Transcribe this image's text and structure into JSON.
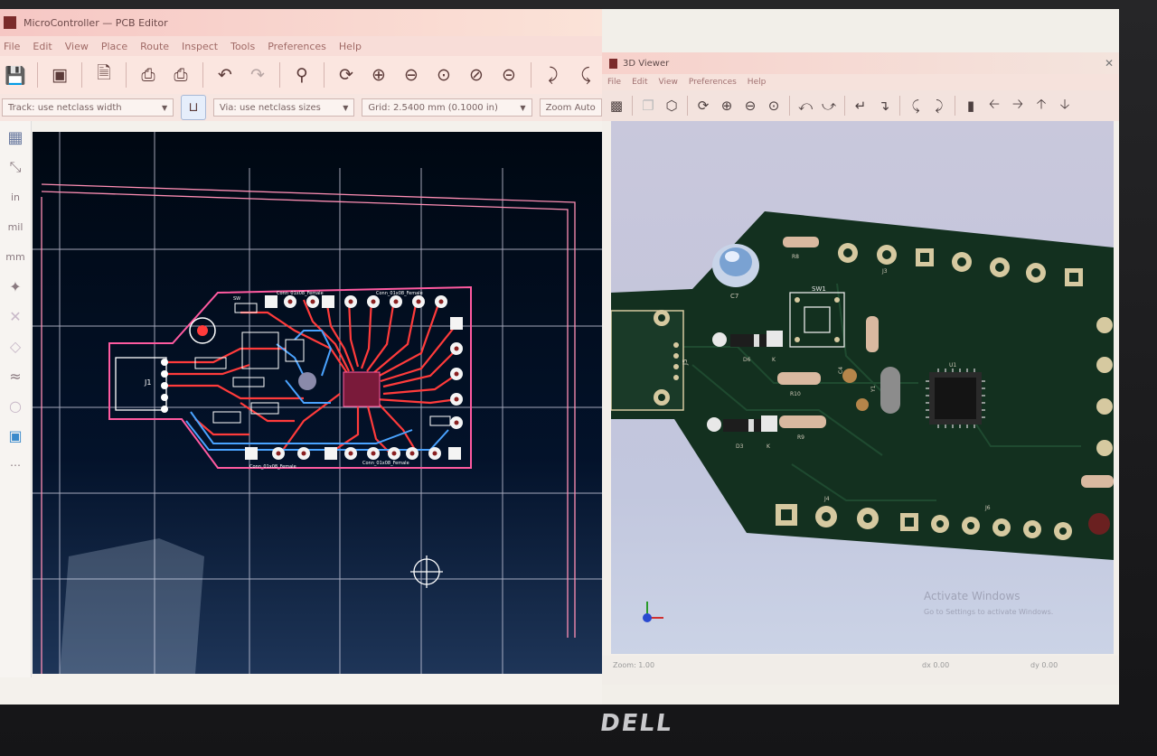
{
  "pcb_editor": {
    "window_title": "MicroController — PCB Editor",
    "menu": [
      "File",
      "Edit",
      "View",
      "Place",
      "Route",
      "Inspect",
      "Tools",
      "Preferences",
      "Help"
    ],
    "toolbar_icons": [
      "save-icon",
      "board-setup-icon",
      "new-page-icon",
      "print-icon",
      "plot-icon",
      "undo-icon",
      "redo-icon",
      "find-icon",
      "refresh-icon",
      "zoom-in-icon",
      "zoom-out-icon",
      "zoom-fit-icon",
      "zoom-objects-icon",
      "zoom-selection-icon",
      "flip-icon",
      "rotate-icon"
    ],
    "track_width": "Track: use netclass width",
    "via_size": "Via: use netclass sizes",
    "grid": "Grid: 2.5400 mm (0.1000 in)",
    "zoom": "Zoom Auto",
    "left_tool_labels": [
      "in",
      "mil",
      "mm"
    ],
    "board_labels": {
      "j1": "J1",
      "top_left": "SW",
      "top_mid": "Conn_01x08_Female",
      "top_right": "Conn_01x08_Female",
      "bottom_left": "Conn_01x08_Female",
      "bottom_right": "Conn_01x08_Female"
    },
    "colors": {
      "board_outline": "#ff5aa0",
      "copper": "#ff3b3b",
      "back_copper": "#4aa3ff",
      "grid": "#e8e8f0",
      "canvas_bg": "#000812"
    }
  },
  "viewer_3d": {
    "window_title": "3D Viewer",
    "menu": [
      "File",
      "Edit",
      "View",
      "Preferences",
      "Help"
    ],
    "toolbar_icons": [
      "render-icon",
      "copy-icon",
      "cube-icon",
      "refresh-icon",
      "zoom-in-icon",
      "zoom-out-icon",
      "zoom-fit-icon",
      "rotate-x-icon",
      "rotate-x-rev-icon",
      "rotate-y-icon",
      "rotate-y-rev-icon",
      "rotate-z-icon",
      "rotate-z-rev-icon",
      "flip-icon",
      "pan-left-icon",
      "pan-right-icon",
      "pan-up-icon",
      "pan-down-icon"
    ],
    "component_labels": {
      "sw": "SW1",
      "c7": "C7",
      "r9": "R9",
      "r10": "R10",
      "d3": "D3",
      "d6": "D6",
      "u1": "U1",
      "j4": "J4",
      "j5": "J5",
      "j6": "J6",
      "y1": "Y1",
      "k1": "K",
      "k2": "K",
      "j3": "J3",
      "c4": "C4",
      "r8": "R8"
    },
    "status": {
      "left": "Zoom: 1.00",
      "mid": "dx 0.00",
      "right": "dy 0.00"
    },
    "watermark_line1": "Activate Windows",
    "watermark_line2": "Go to Settings to activate Windows.",
    "colors": {
      "board": "#13301f",
      "pad": "#d6c9a0",
      "background": "#c7c8dd"
    }
  },
  "laptop": {
    "brand": "DELL"
  }
}
